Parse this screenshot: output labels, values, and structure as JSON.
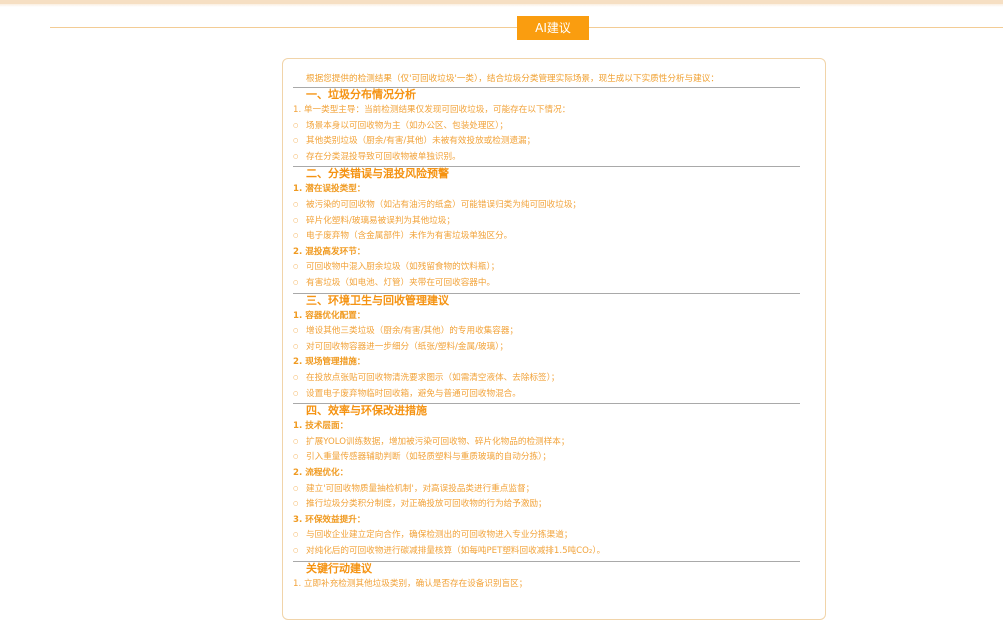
{
  "header": {
    "tab_label": "AI建议"
  },
  "report": {
    "intro": "根据您提供的检测结果（仅'可回收垃圾'一类），结合垃圾分类管理实际场景，现生成以下实质性分析与建议：",
    "sections": [
      {
        "title": "一、垃圾分布情况分析",
        "groups": [
          {
            "heading": "1. 单一类型主导：当前检测结果仅发现可回收垃圾，可能存在以下情况：",
            "heading_plain": true,
            "bullets": [
              "场景本身以可回收物为主（如办公区、包装处理区）；",
              "其他类别垃圾（厨余/有害/其他）未被有效投放或检测遗漏；",
              "存在分类混投导致可回收物被单独识别。"
            ]
          }
        ]
      },
      {
        "title": "二、分类错误与混投风险预警",
        "groups": [
          {
            "heading": "1. 潜在误投类型：",
            "bullets": [
              "被污染的可回收物（如沾有油污的纸盒）可能错误归类为纯可回收垃圾；",
              "碎片化塑料/玻璃易被误判为其他垃圾；",
              "电子废弃物（含金属部件）未作为有害垃圾单独区分。"
            ]
          },
          {
            "heading": "2. 混投高发环节：",
            "bullets": [
              "可回收物中混入厨余垃圾（如残留食物的饮料瓶）；",
              "有害垃圾（如电池、灯管）夹带在可回收容器中。"
            ]
          }
        ]
      },
      {
        "title": "三、环境卫生与回收管理建议",
        "groups": [
          {
            "heading": "1. 容器优化配置：",
            "bullets": [
              "增设其他三类垃圾（厨余/有害/其他）的专用收集容器；",
              "对可回收物容器进一步细分（纸张/塑料/金属/玻璃）；"
            ]
          },
          {
            "heading": "2. 现场管理措施：",
            "bullets": [
              "在投放点张贴可回收物清洗要求图示（如需清空液体、去除标签）；",
              "设置电子废弃物临时回收箱，避免与普通可回收物混合。"
            ]
          }
        ]
      },
      {
        "title": "四、效率与环保改进措施",
        "groups": [
          {
            "heading": "1. 技术层面：",
            "bullets": [
              "扩展YOLO训练数据，增加被污染可回收物、碎片化物品的检测样本；",
              "引入重量传感器辅助判断（如轻质塑料与重质玻璃的自动分拣）；"
            ]
          },
          {
            "heading": "2. 流程优化：",
            "bullets": [
              "建立'可回收物质量抽检机制'，对高误投品类进行重点监督；",
              "推行垃圾分类积分制度，对正确投放可回收物的行为给予激励；"
            ]
          },
          {
            "heading": "3. 环保效益提升：",
            "bullets": [
              "与回收企业建立定向合作，确保检测出的可回收物进入专业分拣渠道；",
              "对纯化后的可回收物进行碳减排量核算（如每吨PET塑料回收减排1.5吨CO₂）。"
            ]
          }
        ]
      },
      {
        "title": "关键行动建议",
        "groups": [
          {
            "heading": "1. 立即补充检测其他垃圾类别，确认是否存在设备识别盲区；",
            "heading_plain": true,
            "bullets": []
          }
        ]
      }
    ]
  },
  "colors": {
    "accent": "#fa9d0f",
    "heading": "#f59312",
    "text": "#f2a33a",
    "panel_border": "#f1d4a9",
    "rule": "#a9a9a9"
  }
}
